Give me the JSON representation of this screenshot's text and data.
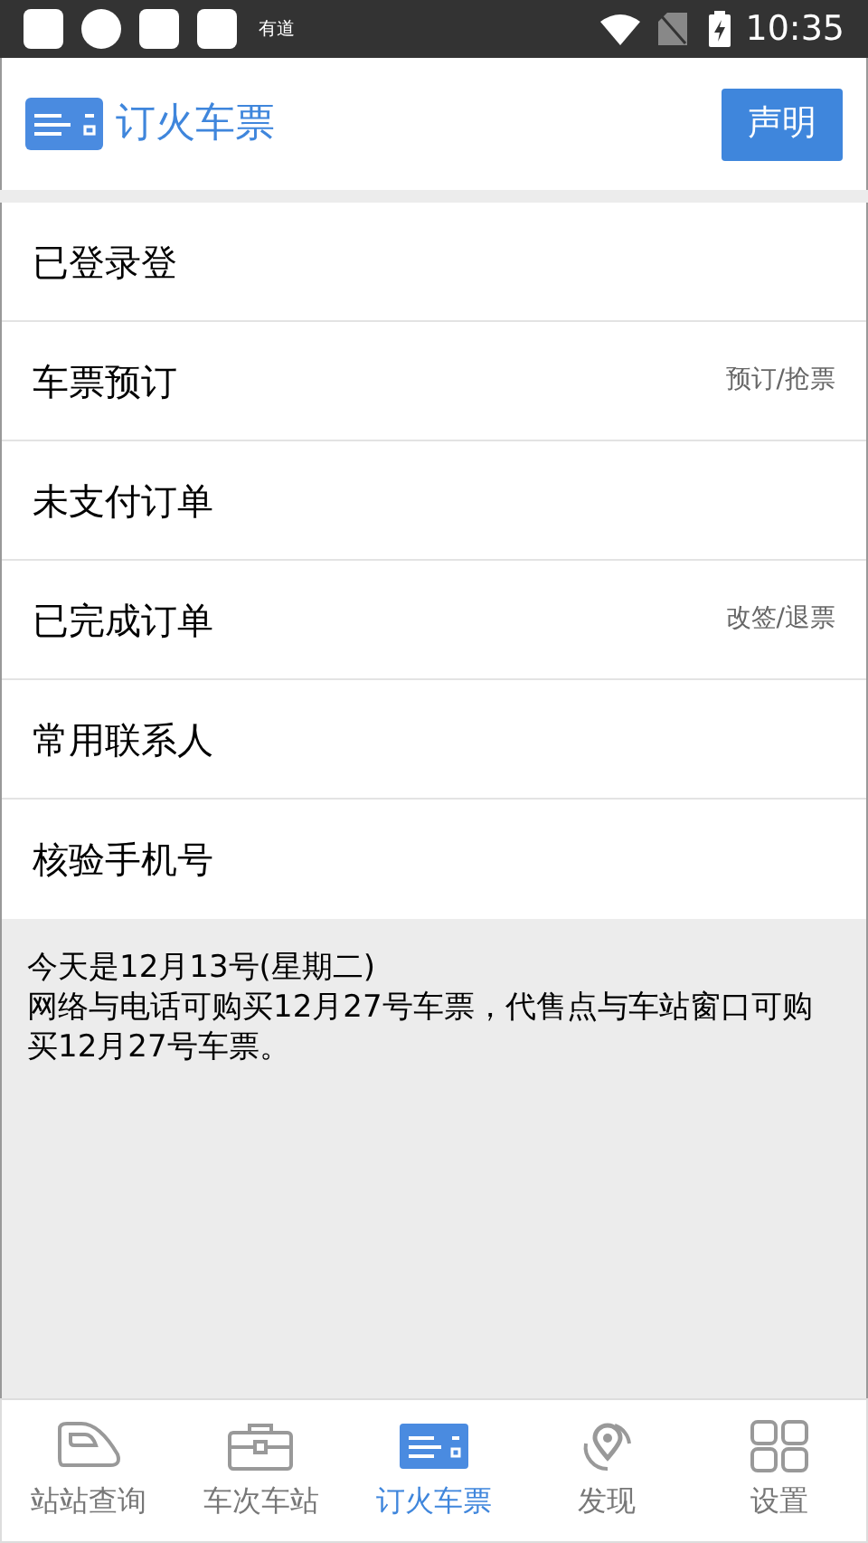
{
  "status_bar": {
    "app_label": "有道",
    "time": "10:35"
  },
  "header": {
    "title": "订火车票",
    "button": "声明"
  },
  "menu": [
    {
      "label": "已登录登"
    },
    {
      "label": "车票预订",
      "hint": "预订/抢票"
    },
    {
      "label": "未支付订单"
    },
    {
      "label": "已完成订单",
      "hint": "改签/退票"
    },
    {
      "label": "常用联系人"
    },
    {
      "label": "核验手机号"
    }
  ],
  "notice": [
    "今天是12月13号(星期二)",
    "网络与电话可购买12月27号车票，代售点与车站窗口可购买12月27号车票。"
  ],
  "tabs": [
    {
      "label": "站站查询",
      "kind": "train",
      "selected": false
    },
    {
      "label": "车次车站",
      "kind": "case",
      "selected": false
    },
    {
      "label": "订火车票",
      "kind": "ticket",
      "selected": true
    },
    {
      "label": "发现",
      "kind": "pin",
      "selected": false
    },
    {
      "label": "设置",
      "kind": "grid",
      "selected": false
    }
  ]
}
